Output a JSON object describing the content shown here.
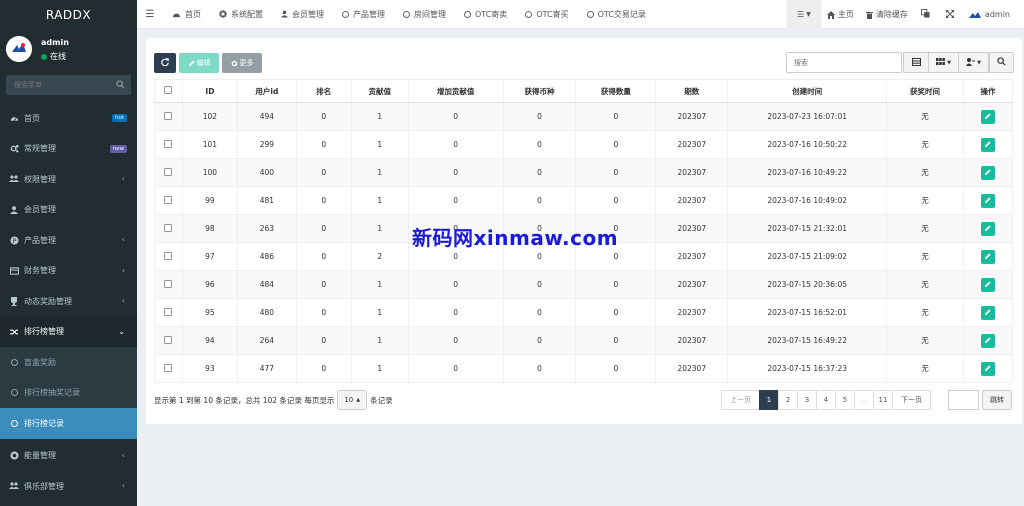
{
  "brand": "RADDX",
  "user": {
    "name": "admin",
    "status": "在线"
  },
  "sidebar": {
    "search_placeholder": "搜索菜单",
    "items": [
      {
        "label": "首页",
        "icon": "dashboard-icon",
        "badge": "hot"
      },
      {
        "label": "常规管理",
        "icon": "cogs-icon",
        "badge": "new"
      },
      {
        "label": "权限管理",
        "icon": "group-icon",
        "chevron": true
      },
      {
        "label": "会员管理",
        "icon": "user-icon"
      },
      {
        "label": "产品管理",
        "icon": "product-icon",
        "chevron": true
      },
      {
        "label": "财务管理",
        "icon": "finance-icon",
        "chevron": true
      },
      {
        "label": "动态奖励管理",
        "icon": "reward-icon",
        "chevron": true
      },
      {
        "label": "排行榜管理",
        "icon": "ranking-icon",
        "open": true
      }
    ],
    "subitems": [
      {
        "label": "盲盒奖励"
      },
      {
        "label": "排行榜抽奖记录"
      },
      {
        "label": "排行榜记录",
        "active": true
      }
    ],
    "items_after": [
      {
        "label": "能量管理",
        "icon": "energy-icon"
      },
      {
        "label": "俱乐部管理",
        "icon": "club-icon"
      }
    ]
  },
  "topbar": {
    "nav": [
      {
        "label": "首页",
        "icon": "dashboard-icon"
      },
      {
        "label": "系统配置",
        "icon": "gear-icon"
      },
      {
        "label": "会员管理",
        "icon": "user-icon"
      },
      {
        "label": "产品管理",
        "icon": "ring-icon"
      },
      {
        "label": "房间管理",
        "icon": "ring-icon"
      },
      {
        "label": "OTC寄卖",
        "icon": "ring-icon"
      },
      {
        "label": "OTC寄买",
        "icon": "ring-icon"
      },
      {
        "label": "OTC交易记录",
        "icon": "ring-icon"
      }
    ],
    "right": {
      "home": "主页",
      "clear_cache": "清除缓存",
      "admin": "admin"
    }
  },
  "toolbar": {
    "edit": "编辑",
    "more": "更多",
    "search_placeholder": "搜索"
  },
  "table": {
    "columns": [
      "ID",
      "用户id",
      "排名",
      "贡献值",
      "增加贡献值",
      "获得币种",
      "获得数量",
      "期数",
      "创建时间",
      "获奖时间",
      "操作"
    ],
    "rows": [
      [
        "102",
        "494",
        "0",
        "1",
        "0",
        "0",
        "0",
        "202307",
        "2023-07-23 16:07:01",
        "无"
      ],
      [
        "101",
        "299",
        "0",
        "1",
        "0",
        "0",
        "0",
        "202307",
        "2023-07-16 10:50:22",
        "无"
      ],
      [
        "100",
        "400",
        "0",
        "1",
        "0",
        "0",
        "0",
        "202307",
        "2023-07-16 10:49:22",
        "无"
      ],
      [
        "99",
        "481",
        "0",
        "1",
        "0",
        "0",
        "0",
        "202307",
        "2023-07-16 10:49:02",
        "无"
      ],
      [
        "98",
        "263",
        "0",
        "1",
        "0",
        "0",
        "0",
        "202307",
        "2023-07-15 21:32:01",
        "无"
      ],
      [
        "97",
        "486",
        "0",
        "2",
        "0",
        "0",
        "0",
        "202307",
        "2023-07-15 21:09:02",
        "无"
      ],
      [
        "96",
        "484",
        "0",
        "1",
        "0",
        "0",
        "0",
        "202307",
        "2023-07-15 20:36:05",
        "无"
      ],
      [
        "95",
        "480",
        "0",
        "1",
        "0",
        "0",
        "0",
        "202307",
        "2023-07-15 16:52:01",
        "无"
      ],
      [
        "94",
        "264",
        "0",
        "1",
        "0",
        "0",
        "0",
        "202307",
        "2023-07-15 16:49:22",
        "无"
      ],
      [
        "93",
        "477",
        "0",
        "1",
        "0",
        "0",
        "0",
        "202307",
        "2023-07-15 16:37:23",
        "无"
      ]
    ]
  },
  "footer": {
    "info": "显示第 1 到第 10 条记录，总共 102 条记录 每页显示",
    "page_size": "10",
    "suffix": "条记录",
    "pages": [
      "上一页",
      "1",
      "2",
      "3",
      "4",
      "5",
      "...",
      "11",
      "下一页"
    ],
    "jump": "跳转"
  },
  "watermark": "新码网xinmaw.com"
}
